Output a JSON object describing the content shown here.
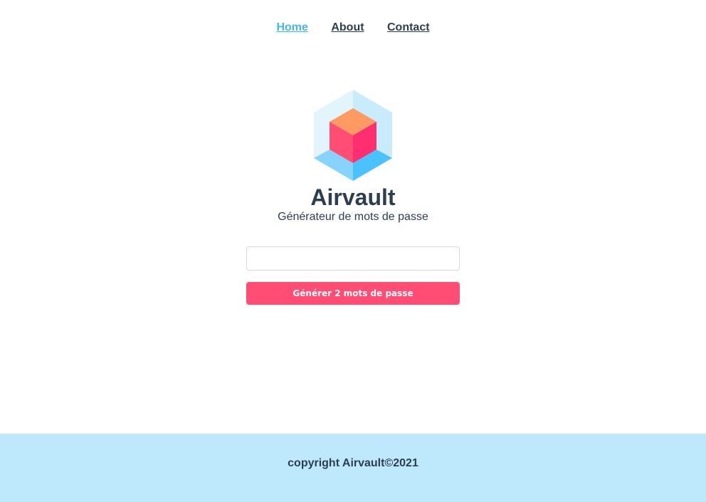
{
  "nav": {
    "items": [
      {
        "label": "Home",
        "active": true
      },
      {
        "label": "About",
        "active": false
      },
      {
        "label": "Contact",
        "active": false
      }
    ]
  },
  "brand": {
    "logo_icon": "hexagon-cube-logo",
    "title": "Airvault",
    "subtitle": "Générateur de mots de passe"
  },
  "form": {
    "input_value": "",
    "input_placeholder": "",
    "generate_label": "Générer 2 mots de passe"
  },
  "footer": {
    "copyright": "copyright Airvault©2021"
  },
  "colors": {
    "text": "#2c3e50",
    "nav_active": "#42b7f5",
    "button": "#ff4d73",
    "footer_bg": "#bee9fc"
  }
}
